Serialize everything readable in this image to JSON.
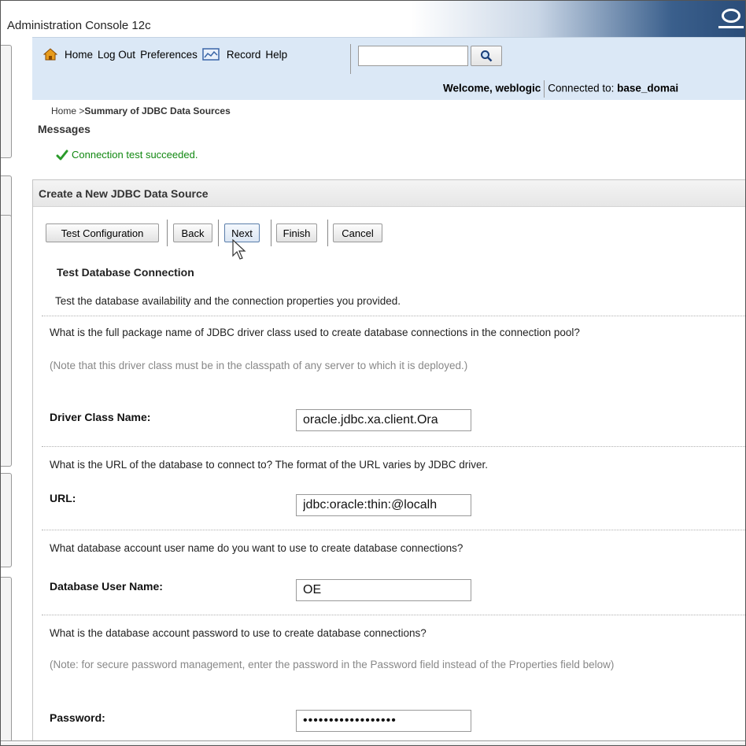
{
  "window": {
    "title": "Administration Console 12c"
  },
  "toolbar": {
    "home": "Home",
    "logout": "Log Out",
    "preferences": "Preferences",
    "record": "Record",
    "help": "Help",
    "search_value": "",
    "welcome_prefix": "Welcome, weblogic",
    "connected_label": "Connected to:",
    "domain": "base_domai"
  },
  "breadcrumb": {
    "home": "Home >",
    "current": "Summary of JDBC Data Sources"
  },
  "messages": {
    "title": "Messages",
    "success": "Connection test succeeded."
  },
  "panel": {
    "title": "Create a New JDBC Data Source",
    "buttons": {
      "test": "Test Configuration",
      "back": "Back",
      "next": "Next",
      "finish": "Finish",
      "cancel": "Cancel"
    },
    "section_title": "Test Database Connection",
    "section_desc": "Test the database availability and the connection properties you provided."
  },
  "form": {
    "driver_question": "What is the full package name of JDBC driver class used to create database connections in the connection pool?",
    "driver_note": "(Note that this driver class must be in the classpath of any server to which it is deployed.)",
    "driver_label": "Driver Class Name:",
    "driver_value": "oracle.jdbc.xa.client.Ora",
    "url_question": "What is the URL of the database to connect to? The format of the URL varies by JDBC driver.",
    "url_label": "URL:",
    "url_value": "jdbc:oracle:thin:@localh",
    "user_question": "What database account user name do you want to use to create database connections?",
    "user_label": "Database User Name:",
    "user_value": "OE",
    "password_question": "What is the database account password to use to create database connections?",
    "password_note": "(Note: for secure password management, enter the password in the Password field instead of the Properties field below)",
    "password_label": "Password:",
    "password_value": "••••••••••••••••••"
  },
  "colors": {
    "toolbar_bg": "#dbe8f6",
    "success_text": "#118811",
    "title_gradient_end": "#2a4c78"
  }
}
